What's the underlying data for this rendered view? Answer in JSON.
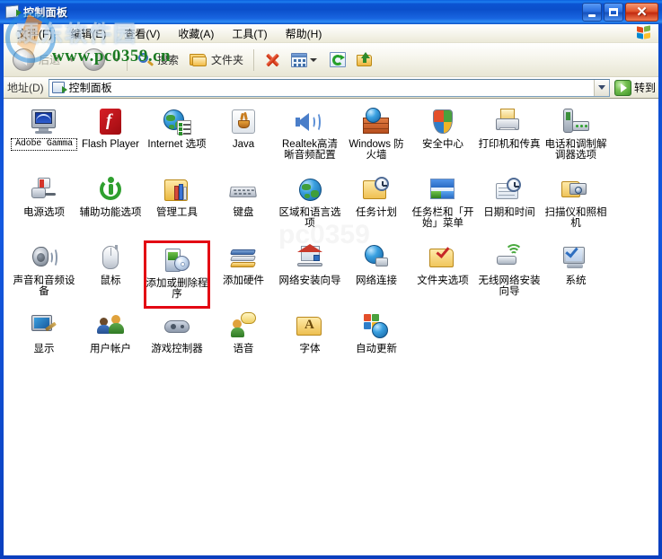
{
  "window": {
    "title": "控制面板",
    "icon": "control-panel-icon",
    "buttons": {
      "minimize": "最小化",
      "maximize": "最大化",
      "close": "关闭"
    }
  },
  "menubar": {
    "items": [
      {
        "label": "文件(F)"
      },
      {
        "label": "编辑(E)"
      },
      {
        "label": "查看(V)"
      },
      {
        "label": "收藏(A)"
      },
      {
        "label": "工具(T)"
      },
      {
        "label": "帮助(H)"
      }
    ],
    "brand_icon": "windows-flag-icon"
  },
  "toolbar": {
    "back_label": "后退",
    "forward_label": "",
    "search_label": "搜索",
    "folders_label": "文件夹",
    "delete_icon": "delete-x-icon",
    "views_icon": "views-icon",
    "refresh_icon": "refresh-icon",
    "up_icon": "up-folder-icon"
  },
  "addressbar": {
    "label": "地址(D)",
    "value": "控制面板",
    "icon": "control-panel-icon",
    "dropdown_icon": "chevron-down-icon",
    "go_label": "转到"
  },
  "watermarks": {
    "top": "硬东软件园",
    "url": "www.pc0359.cn",
    "center": "pc0359"
  },
  "content": {
    "highlighted_item": "添加或删除程序",
    "focused_item": "Adobe Gamma",
    "items": [
      {
        "label": "Adobe Gamma",
        "icon": "adobe-gamma-icon",
        "focused": true,
        "highlighted": false
      },
      {
        "label": "Flash Player",
        "icon": "flash-player-icon",
        "focused": false,
        "highlighted": false
      },
      {
        "label": "Internet 选项",
        "icon": "internet-options-icon",
        "focused": false,
        "highlighted": false
      },
      {
        "label": "Java",
        "icon": "java-icon",
        "focused": false,
        "highlighted": false
      },
      {
        "label": "Realtek高清晰音频配置",
        "icon": "realtek-audio-icon",
        "focused": false,
        "highlighted": false
      },
      {
        "label": "Windows 防火墙",
        "icon": "windows-firewall-icon",
        "focused": false,
        "highlighted": false
      },
      {
        "label": "安全中心",
        "icon": "security-center-icon",
        "focused": false,
        "highlighted": false
      },
      {
        "label": "打印机和传真",
        "icon": "printers-and-faxes-icon",
        "focused": false,
        "highlighted": false
      },
      {
        "label": "电话和调制解调器选项",
        "icon": "phone-and-modem-icon",
        "focused": false,
        "highlighted": false
      },
      {
        "label": "电源选项",
        "icon": "power-options-icon",
        "focused": false,
        "highlighted": false
      },
      {
        "label": "辅助功能选项",
        "icon": "accessibility-options-icon",
        "focused": false,
        "highlighted": false
      },
      {
        "label": "管理工具",
        "icon": "administrative-tools-icon",
        "focused": false,
        "highlighted": false
      },
      {
        "label": "键盘",
        "icon": "keyboard-icon",
        "focused": false,
        "highlighted": false
      },
      {
        "label": "区域和语言选项",
        "icon": "regional-language-icon",
        "focused": false,
        "highlighted": false
      },
      {
        "label": "任务计划",
        "icon": "scheduled-tasks-icon",
        "focused": false,
        "highlighted": false
      },
      {
        "label": "任务栏和「开始」菜单",
        "icon": "taskbar-start-menu-icon",
        "focused": false,
        "highlighted": false
      },
      {
        "label": "日期和时间",
        "icon": "date-and-time-icon",
        "focused": false,
        "highlighted": false
      },
      {
        "label": "扫描仪和照相机",
        "icon": "scanners-cameras-icon",
        "focused": false,
        "highlighted": false
      },
      {
        "label": "声音和音频设备",
        "icon": "sounds-audio-devices-icon",
        "focused": false,
        "highlighted": false
      },
      {
        "label": "鼠标",
        "icon": "mouse-icon",
        "focused": false,
        "highlighted": false
      },
      {
        "label": "添加或删除程序",
        "icon": "add-remove-programs-icon",
        "focused": false,
        "highlighted": true
      },
      {
        "label": "添加硬件",
        "icon": "add-hardware-icon",
        "focused": false,
        "highlighted": false
      },
      {
        "label": "网络安装向导",
        "icon": "network-setup-wizard-icon",
        "focused": false,
        "highlighted": false
      },
      {
        "label": "网络连接",
        "icon": "network-connections-icon",
        "focused": false,
        "highlighted": false
      },
      {
        "label": "文件夹选项",
        "icon": "folder-options-icon",
        "focused": false,
        "highlighted": false
      },
      {
        "label": "无线网络安装向导",
        "icon": "wireless-network-setup-icon",
        "focused": false,
        "highlighted": false
      },
      {
        "label": "系统",
        "icon": "system-icon",
        "focused": false,
        "highlighted": false
      },
      {
        "label": "显示",
        "icon": "display-icon",
        "focused": false,
        "highlighted": false
      },
      {
        "label": "用户帐户",
        "icon": "user-accounts-icon",
        "focused": false,
        "highlighted": false
      },
      {
        "label": "游戏控制器",
        "icon": "game-controllers-icon",
        "focused": false,
        "highlighted": false
      },
      {
        "label": "语音",
        "icon": "speech-icon",
        "focused": false,
        "highlighted": false
      },
      {
        "label": "字体",
        "icon": "fonts-icon",
        "focused": false,
        "highlighted": false
      },
      {
        "label": "自动更新",
        "icon": "automatic-updates-icon",
        "focused": false,
        "highlighted": false
      }
    ]
  },
  "colors": {
    "titlebar_blue": "#0b4fcb",
    "highlight_red": "#e30613",
    "watermark_green": "#1b7a22"
  }
}
